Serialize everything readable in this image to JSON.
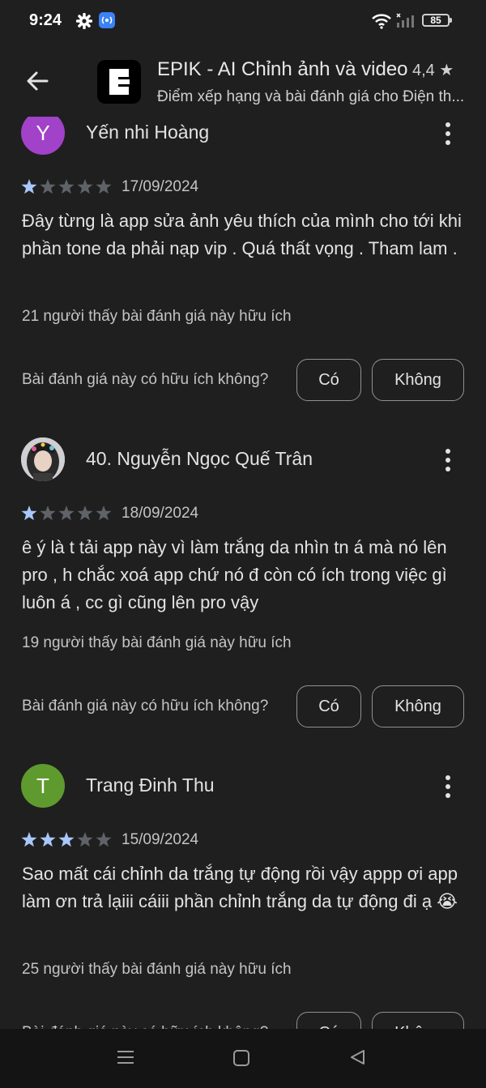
{
  "status_bar": {
    "time": "9:24",
    "battery": "85"
  },
  "header": {
    "app_title": "EPIK - AI Chỉnh ảnh và video",
    "rating": "4,4",
    "rating_star": "★",
    "subtitle": "Điểm xếp hạng và bài đánh giá cho Điện th..."
  },
  "question_label": "Bài đánh giá này có hữu ích không?",
  "yes_label": "Có",
  "no_label": "Không",
  "reviews": [
    {
      "avatar_letter": "Y",
      "avatar_color": "#a142c9",
      "author": "Yến nhi Hoàng",
      "stars": 1,
      "date": "17/09/2024",
      "text": "Đây từng là app sửa ảnh yêu thích của mình cho tới khi phần tone da phải nạp vip . Quá thất vọng . Tham lam .",
      "helpful": "21 người thấy bài đánh giá này hữu ích"
    },
    {
      "avatar_letter": "",
      "avatar_color": "#cfcfd4",
      "author": "40. Nguyễn Ngọc Quế Trân",
      "stars": 1,
      "date": "18/09/2024",
      "text": "ê ý là t tải app này vì làm trắng da nhìn tn á mà nó lên pro , h chắc xoá app chứ nó đ còn có ích trong việc gì luôn á , cc gì cũng lên pro vậy",
      "helpful": "19 người thấy bài đánh giá này hữu ích"
    },
    {
      "avatar_letter": "T",
      "avatar_color": "#5f9a2f",
      "author": "Trang Đinh Thu",
      "stars": 3,
      "date": "15/09/2024",
      "text": "Sao mất cái chỉnh da trắng tự động rồi vậy appp ơi app làm ơn trả lạiii cáiii phần chỉnh trắng da tự động đi ạ 😭",
      "helpful": "25 người thấy bài đánh giá này hữu ích"
    }
  ],
  "colors": {
    "background": "#1f1f1f",
    "star_filled": "#a8c7fa",
    "star_empty": "#5f6368"
  }
}
